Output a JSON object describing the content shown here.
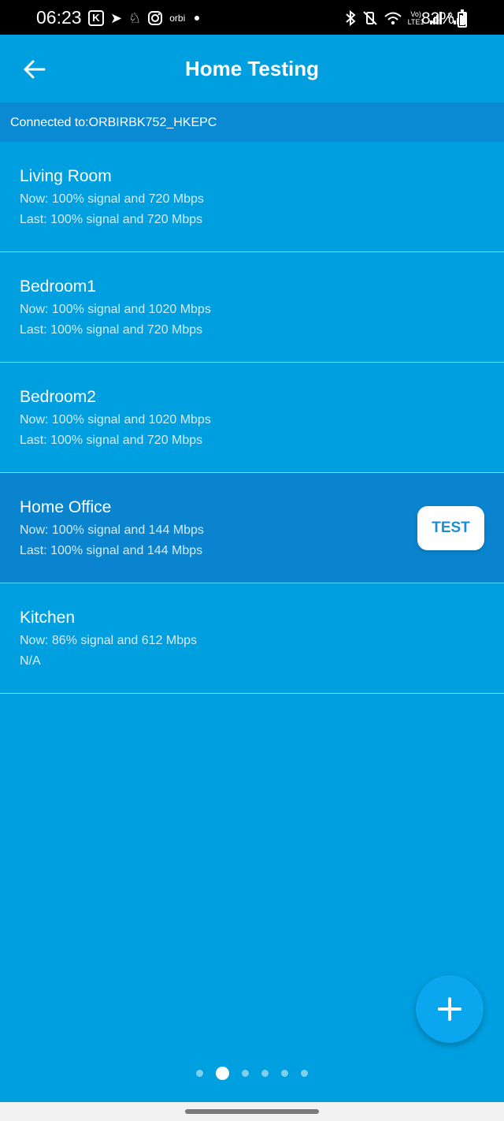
{
  "status_bar": {
    "time": "06:23",
    "battery_percent": "83%",
    "network_label": "LTE1",
    "volte_label": "Vo)",
    "roaming_label": "R",
    "orbi_label": "orbi"
  },
  "header": {
    "title": "Home Testing"
  },
  "connection": {
    "text": "Connected to:ORBIRBK752_HKEPC"
  },
  "rooms": [
    {
      "name": "Living Room",
      "now": "Now: 100% signal and 720 Mbps",
      "last": "Last: 100% signal and 720 Mbps"
    },
    {
      "name": "Bedroom1",
      "now": "Now: 100% signal and 1020 Mbps",
      "last": "Last: 100% signal and 720 Mbps"
    },
    {
      "name": "Bedroom2",
      "now": "Now: 100% signal and 1020 Mbps",
      "last": "Last: 100% signal and 720 Mbps"
    },
    {
      "name": "Home Office",
      "now": "Now: 100% signal and 144 Mbps",
      "last": "Last: 100% signal and 144 Mbps",
      "action_label": "TEST"
    },
    {
      "name": "Kitchen",
      "now": "Now: 86% signal and 612 Mbps",
      "last": "N/A"
    }
  ],
  "pagination": {
    "total_pages": 6,
    "current_page": 2
  },
  "colors": {
    "background": "#009fdf",
    "connection_bar": "#0a8ad2",
    "selected_row": "#0a84cf",
    "test_button_text": "#1a8fd2",
    "fab": "#0aa6ee"
  },
  "icons": {
    "back": "arrow-left-icon",
    "add": "plus-icon"
  }
}
